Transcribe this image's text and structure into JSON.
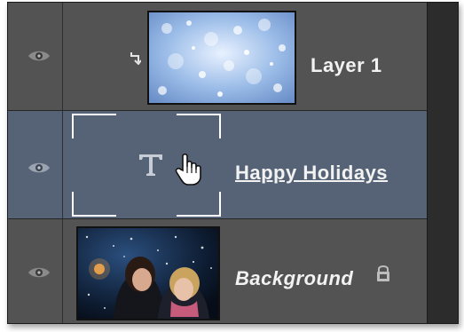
{
  "layers": [
    {
      "name": "Layer 1",
      "visible_icon": "eye-icon",
      "clipping_icon": "clipping-mask-arrow-icon",
      "thumbnail": "blue-bokeh-snow-texture"
    },
    {
      "name": "Happy Holidays",
      "visible_icon": "eye-icon",
      "type_icon": "T",
      "cursor_icon": "hand-pointer-icon",
      "selected": true
    },
    {
      "name": "Background",
      "visible_icon": "eye-icon",
      "lock_icon": "lock-icon",
      "thumbnail": "photo-two-women-in-snow"
    }
  ],
  "colors": {
    "panel_bg": "#535353",
    "selected_row_bg": "#566376",
    "text": "#f2f2f2",
    "scrollbar": "#2c2c2c"
  }
}
